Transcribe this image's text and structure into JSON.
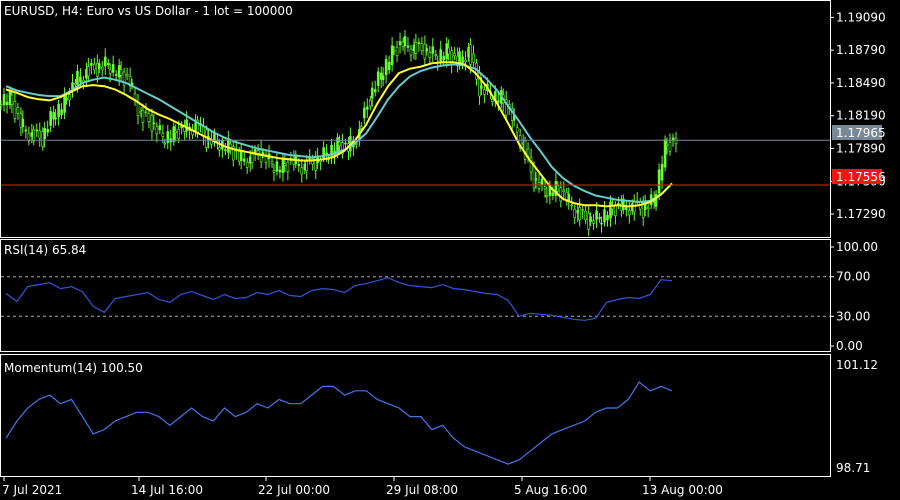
{
  "symbol_title": "EURUSD, H4:  Euro vs US Dollar - 1 lot = 100000",
  "colors": {
    "background": "#000000",
    "border": "#ffffff",
    "candles": "#66ff33",
    "ma_fast": "#ffff33",
    "ma_slow": "#66cccc",
    "rsi_line": "#3355dd",
    "momentum_line": "#4477ee",
    "bid_line": "#778899",
    "red_line": "#ff1111"
  },
  "price_axis": {
    "ticks": [
      "1.19090",
      "1.18790",
      "1.18490",
      "1.18190",
      "1.17890",
      "1.17590",
      "1.17290"
    ],
    "ymin": 1.1708,
    "ymax": 1.1924,
    "bid_value": 1.17965,
    "bid_label": "1.17965",
    "red_value": 1.17556,
    "red_label": "1.17556"
  },
  "rsi": {
    "title": "RSI(14) 65.84",
    "ticks": [
      "100.00",
      "70.00",
      "30.00",
      "0.00"
    ],
    "levels": [
      70,
      30
    ]
  },
  "momentum": {
    "title": "Momentum(14) 100.50",
    "top_label": "101.12",
    "bottom_label": "98.71",
    "min": 98.71,
    "max": 101.12
  },
  "time_axis": [
    "7 Jul 2021",
    "14 Jul 16:00",
    "22 Jul 00:00",
    "29 Jul 08:00",
    "5 Aug 16:00",
    "13 Aug 00:00"
  ],
  "chart_data": {
    "type": "line",
    "xlabel": "",
    "ylabel": "",
    "x": [
      "7 Jul 2021",
      "14 Jul 16:00",
      "22 Jul 00:00",
      "29 Jul 08:00",
      "5 Aug 16:00",
      "13 Aug 00:00"
    ],
    "price_close": [
      1.1835,
      1.1812,
      1.18,
      1.1798,
      1.1822,
      1.183,
      1.1851,
      1.1858,
      1.1862,
      1.1867,
      1.1858,
      1.185,
      1.1818,
      1.1812,
      1.18,
      1.1802,
      1.1808,
      1.1809,
      1.1797,
      1.1796,
      1.179,
      1.1781,
      1.1778,
      1.1784,
      1.1775,
      1.1772,
      1.1778,
      1.1771,
      1.1776,
      1.1785,
      1.1792,
      1.179,
      1.1803,
      1.1835,
      1.1858,
      1.1876,
      1.1886,
      1.188,
      1.1878,
      1.1874,
      1.1878,
      1.1868,
      1.1878,
      1.1844,
      1.184,
      1.1835,
      1.1818,
      1.179,
      1.176,
      1.1752,
      1.1752,
      1.1744,
      1.1729,
      1.1722,
      1.1726,
      1.1733,
      1.1736,
      1.1735,
      1.1733,
      1.1742,
      1.179,
      1.1797
    ],
    "series": [
      {
        "name": "RSI(14)",
        "values": [
          53,
          45,
          60,
          62,
          64,
          58,
          60,
          55,
          40,
          34,
          48,
          50,
          52,
          54,
          47,
          44,
          52,
          55,
          51,
          47,
          52,
          48,
          49,
          54,
          52,
          56,
          51,
          50,
          56,
          58,
          57,
          54,
          61,
          63,
          66,
          69,
          64,
          61,
          60,
          59,
          62,
          58,
          57,
          55,
          53,
          52,
          46,
          30,
          33,
          32,
          31,
          29,
          27,
          26,
          28,
          44,
          47,
          49,
          48,
          52,
          67,
          66
        ]
      },
      {
        "name": "Momentum(14)",
        "values": [
          99.4,
          99.8,
          100.1,
          100.3,
          100.4,
          100.2,
          100.3,
          99.9,
          99.5,
          99.6,
          99.8,
          99.9,
          100.0,
          100.0,
          99.9,
          99.7,
          99.9,
          100.1,
          99.9,
          99.8,
          100.1,
          99.9,
          100.0,
          100.2,
          100.1,
          100.3,
          100.2,
          100.2,
          100.4,
          100.6,
          100.6,
          100.4,
          100.5,
          100.5,
          100.3,
          100.2,
          100.1,
          99.9,
          99.9,
          99.6,
          99.7,
          99.4,
          99.2,
          99.1,
          99.0,
          98.9,
          98.8,
          98.9,
          99.1,
          99.3,
          99.5,
          99.6,
          99.7,
          99.8,
          100.0,
          100.1,
          100.1,
          100.3,
          100.7,
          100.5,
          100.6,
          100.5
        ]
      }
    ],
    "ma_fast": [
      1.1843,
      1.184,
      1.1836,
      1.1834,
      1.1833,
      1.1836,
      1.1841,
      1.1846,
      1.1847,
      1.1846,
      1.1843,
      1.1838,
      1.1832,
      1.1825,
      1.182,
      1.1816,
      1.1811,
      1.1806,
      1.1801,
      1.1796,
      1.1791,
      1.1788,
      1.1786,
      1.1784,
      1.1782,
      1.178,
      1.1779,
      1.1778,
      1.1778,
      1.1779,
      1.1781,
      1.1787,
      1.1797,
      1.1811,
      1.183,
      1.1846,
      1.1858,
      1.1862,
      1.1864,
      1.1867,
      1.1868,
      1.1868,
      1.1866,
      1.1858,
      1.1846,
      1.183,
      1.1812,
      1.1793,
      1.1778,
      1.1765,
      1.1752,
      1.1743,
      1.1739,
      1.1737,
      1.1737,
      1.1736,
      1.1737,
      1.1736,
      1.1737,
      1.174,
      1.1747,
      1.1757
    ],
    "ma_slow": [
      1.1846,
      1.1842,
      1.184,
      1.1838,
      1.1837,
      1.1837,
      1.1842,
      1.1849,
      1.1852,
      1.1854,
      1.1852,
      1.1849,
      1.1844,
      1.1839,
      1.1834,
      1.1828,
      1.1822,
      1.1816,
      1.181,
      1.1804,
      1.1799,
      1.1795,
      1.1792,
      1.1789,
      1.1787,
      1.1785,
      1.1783,
      1.1782,
      1.1781,
      1.1782,
      1.1784,
      1.1788,
      1.1794,
      1.1803,
      1.1818,
      1.1834,
      1.1846,
      1.1855,
      1.186,
      1.1863,
      1.1865,
      1.1866,
      1.1865,
      1.1862,
      1.1853,
      1.1842,
      1.1828,
      1.1814,
      1.1799,
      1.1786,
      1.1772,
      1.1762,
      1.1755,
      1.175,
      1.1746,
      1.1744,
      1.1742,
      1.1741,
      1.174,
      1.1741,
      1.1747,
      1.1757
    ]
  }
}
